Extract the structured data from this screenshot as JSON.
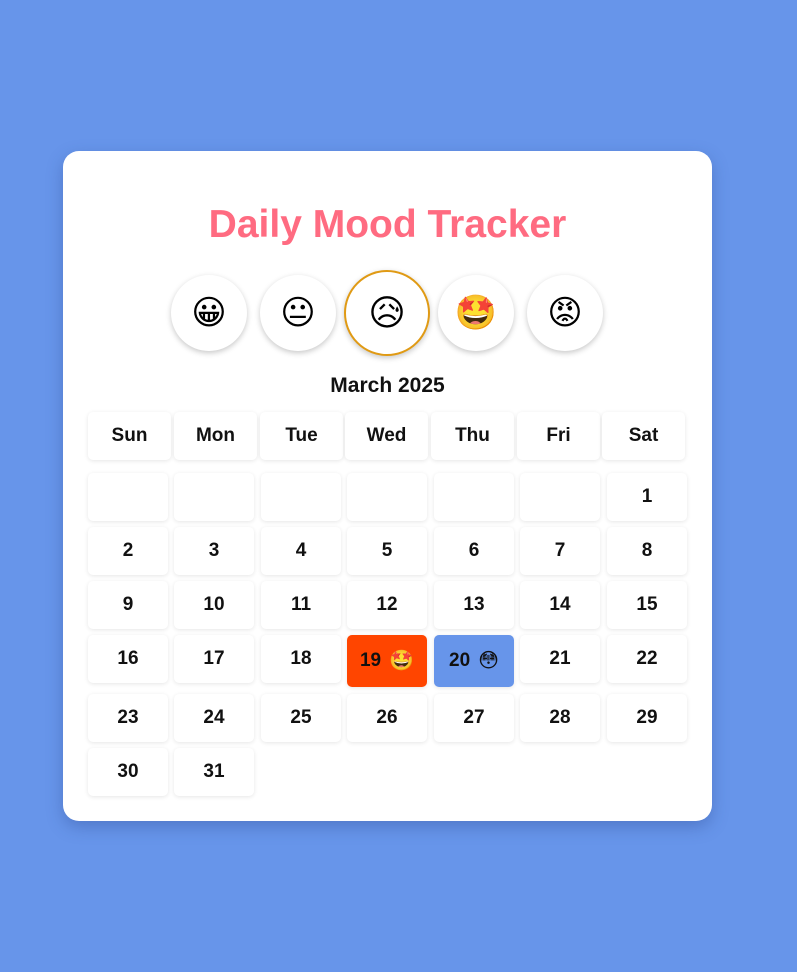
{
  "app": {
    "title": "Daily Mood Tracker"
  },
  "moods": [
    {
      "icon": "grinning-face-icon",
      "glyph": "😀",
      "selected": false
    },
    {
      "icon": "neutral-face-icon",
      "glyph": "😐",
      "selected": false
    },
    {
      "icon": "sad-tear-face-icon",
      "glyph": "😥",
      "selected": true
    },
    {
      "icon": "star-struck-face-icon",
      "glyph": "🤩",
      "selected": false
    },
    {
      "icon": "angry-face-icon",
      "glyph": "😡",
      "selected": false
    }
  ],
  "calendar": {
    "month_label": "March 2025",
    "weekdays": [
      "Sun",
      "Mon",
      "Tue",
      "Wed",
      "Thu",
      "Fri",
      "Sat"
    ],
    "leading_blanks": 6,
    "days": [
      "1",
      "2",
      "3",
      "4",
      "5",
      "6",
      "7",
      "8",
      "9",
      "10",
      "11",
      "12",
      "13",
      "14",
      "15",
      "16",
      "17",
      "18",
      "19",
      "20",
      "21",
      "22",
      "23",
      "24",
      "25",
      "26",
      "27",
      "28",
      "29",
      "30",
      "31"
    ],
    "logged": {
      "19": {
        "glyph": "🤩",
        "icon": "star-struck-face-icon",
        "color": "#ff4500"
      },
      "20": {
        "glyph": "😳",
        "icon": "flushed-face-icon",
        "color": "#6795ea"
      }
    }
  },
  "colors": {
    "background": "#6795ea",
    "title": "#ff6b81",
    "selected_border": "#e09a14"
  }
}
